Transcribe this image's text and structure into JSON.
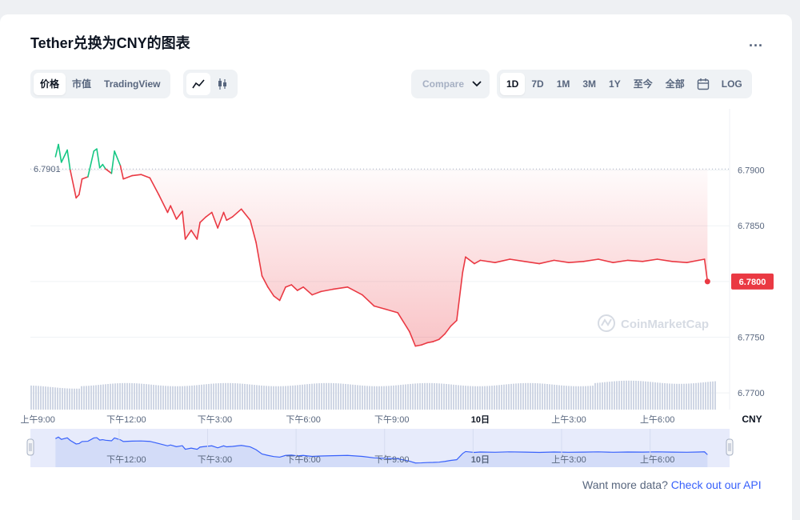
{
  "header": {
    "title": "Tether兑换为CNY的图表",
    "more_label": "..."
  },
  "toolbar": {
    "view_tabs": [
      "价格",
      "市值",
      "TradingView"
    ],
    "compare_label": "Compare",
    "range_tabs": [
      "1D",
      "7D",
      "1M",
      "3M",
      "1Y",
      "至今",
      "全部"
    ],
    "active_range": "1D",
    "log_label": "LOG"
  },
  "colors": {
    "up": "#16c784",
    "down": "#ea3943",
    "accent": "#3861fb",
    "axis_text": "#58667e",
    "volume": "#cfd6e4",
    "navigator_line": "#3861fb"
  },
  "watermark": "CoinMarketCap",
  "footer": {
    "prompt": "Want more data?",
    "link": "Check out our API"
  },
  "chart_data": {
    "type": "line",
    "title": "Tether兑换为CNY的图表",
    "currency_label": "CNY",
    "reference_value": 6.7901,
    "reference_label": "6.7901",
    "last_value": 6.78,
    "last_label": "6.7800",
    "ylim": [
      6.7685,
      6.7955
    ],
    "y_ticks": [
      6.79,
      6.785,
      6.78,
      6.775,
      6.77
    ],
    "y_tick_labels": [
      "6.7900",
      "6.7850",
      "6.7800",
      "6.7750",
      "6.7700"
    ],
    "x_range": [
      8.75,
      32.45
    ],
    "x_ticks": [
      9,
      12,
      15,
      18,
      21,
      24,
      27,
      30
    ],
    "x_tick_labels": [
      "上午9:00",
      "下午12:00",
      "下午3:00",
      "下午6:00",
      "下午9:00",
      "10日",
      "上午3:00",
      "上午6:00"
    ],
    "navigator_tick_labels": [
      "下午12:00",
      "下午3:00",
      "下午6:00",
      "下午9:00",
      "10日",
      "上午3:00",
      "上午6:00"
    ],
    "x": [
      9.6,
      9.7,
      9.8,
      10.0,
      10.1,
      10.3,
      10.4,
      10.5,
      10.7,
      10.9,
      11.0,
      11.1,
      11.2,
      11.3,
      11.5,
      11.6,
      11.8,
      11.9,
      12.2,
      12.5,
      12.8,
      13.1,
      13.4,
      13.5,
      13.7,
      13.9,
      14.0,
      14.2,
      14.4,
      14.5,
      14.7,
      14.9,
      15.1,
      15.3,
      15.4,
      15.6,
      15.9,
      16.2,
      16.4,
      16.6,
      16.8,
      17.0,
      17.2,
      17.4,
      17.6,
      17.8,
      18.0,
      18.3,
      18.6,
      19.0,
      19.5,
      20.0,
      20.4,
      20.8,
      21.2,
      21.6,
      21.8,
      22.0,
      22.2,
      22.4,
      22.6,
      22.8,
      23.0,
      23.2,
      23.4,
      23.5,
      23.6,
      23.8,
      24.0,
      24.5,
      25.0,
      25.5,
      26.0,
      26.5,
      27.0,
      27.5,
      28.0,
      28.5,
      29.0,
      29.5,
      30.0,
      30.5,
      31.0,
      31.4,
      31.6,
      31.7
    ],
    "y": [
      6.7912,
      6.7923,
      6.7907,
      6.7918,
      6.79,
      6.7875,
      6.7878,
      6.7892,
      6.7894,
      6.7917,
      6.7919,
      6.7902,
      6.7905,
      6.7901,
      6.7897,
      6.7917,
      6.7904,
      6.7892,
      6.7895,
      6.7896,
      6.7893,
      6.7878,
      6.7862,
      6.7868,
      6.7856,
      6.7863,
      6.7838,
      6.7846,
      6.7838,
      6.7853,
      6.7858,
      6.7862,
      6.7848,
      6.7862,
      6.7855,
      6.7858,
      6.7865,
      6.7855,
      6.7835,
      6.7805,
      6.7795,
      6.7787,
      6.7783,
      6.7795,
      6.7797,
      6.7792,
      6.7795,
      6.7788,
      6.7791,
      6.7793,
      6.7795,
      6.7788,
      6.7778,
      6.7775,
      6.7772,
      6.7755,
      6.7742,
      6.7743,
      6.7745,
      6.7746,
      6.7748,
      6.7753,
      6.776,
      6.7765,
      6.7808,
      6.7822,
      6.782,
      6.7816,
      6.7819,
      6.7817,
      6.782,
      6.7818,
      6.7816,
      6.7819,
      6.7817,
      6.7818,
      6.782,
      6.7817,
      6.7819,
      6.7818,
      6.782,
      6.7818,
      6.7817,
      6.7819,
      6.782,
      6.78
    ],
    "volume_level": 0.65,
    "grid": true,
    "legend": "none"
  }
}
